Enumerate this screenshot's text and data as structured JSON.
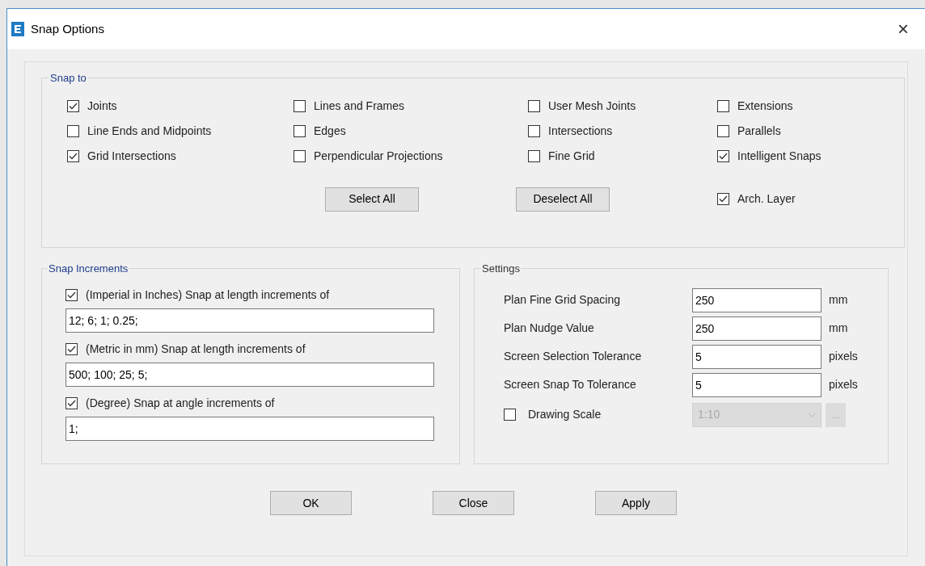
{
  "window": {
    "title": "Snap Options",
    "close": "×"
  },
  "snap_to": {
    "title": "Snap to",
    "items": [
      {
        "label": "Joints",
        "checked": true
      },
      {
        "label": "Lines and Frames",
        "checked": false
      },
      {
        "label": "User Mesh Joints",
        "checked": false
      },
      {
        "label": "Extensions",
        "checked": false
      },
      {
        "label": "Line Ends and Midpoints",
        "checked": false
      },
      {
        "label": "Edges",
        "checked": false
      },
      {
        "label": "Intersections",
        "checked": false
      },
      {
        "label": "Parallels",
        "checked": false
      },
      {
        "label": "Grid Intersections",
        "checked": true
      },
      {
        "label": "Perpendicular Projections",
        "checked": false
      },
      {
        "label": "Fine Grid",
        "checked": false
      },
      {
        "label": "Intelligent Snaps",
        "checked": true
      }
    ],
    "buttons": [
      "Select All",
      "Deselect All"
    ],
    "arch_layer": {
      "label": "Arch. Layer",
      "checked": true
    }
  },
  "snap_increments": {
    "title": "Snap Increments",
    "items": [
      {
        "label": "(Imperial in Inches) Snap at length increments of",
        "checked": true,
        "value": "12; 6; 1; 0.25;"
      },
      {
        "label": "(Metric in mm) Snap at length increments of",
        "checked": true,
        "value": "500; 100; 25; 5;"
      },
      {
        "label": "(Degree) Snap at angle increments of",
        "checked": true,
        "value": "1;"
      }
    ]
  },
  "settings": {
    "title": "Settings",
    "rows": [
      {
        "label": "Plan Fine Grid Spacing",
        "value": "250",
        "unit": "mm"
      },
      {
        "label": "Plan Nudge Value",
        "value": "250",
        "unit": "mm"
      },
      {
        "label": "Screen Selection Tolerance",
        "value": "5",
        "unit": "pixels"
      },
      {
        "label": "Screen Snap To Tolerance",
        "value": "5",
        "unit": "pixels"
      }
    ],
    "drawing_scale": {
      "label": "Drawing Scale",
      "checked": false,
      "value": "1:10",
      "more": "..."
    }
  },
  "buttons": [
    "OK",
    "Close",
    "Apply"
  ]
}
